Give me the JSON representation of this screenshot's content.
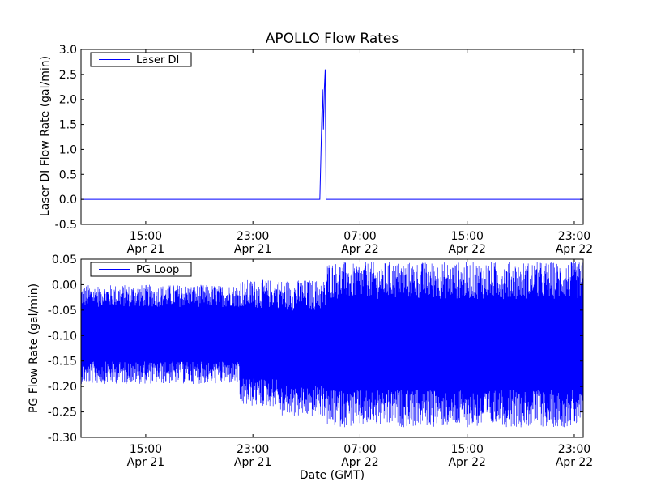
{
  "chart_data": [
    {
      "type": "line",
      "title": "APOLLO Flow Rates",
      "xlabel": "",
      "ylabel": "Laser DI Flow Rate (gal/min)",
      "ylim": [
        -0.5,
        3.0
      ],
      "yticks": [
        "-0.5",
        "0.0",
        "0.5",
        "1.0",
        "1.5",
        "2.0",
        "2.5",
        "3.0"
      ],
      "xticks": [
        {
          "time": "15:00",
          "date": "Apr 21"
        },
        {
          "time": "23:00",
          "date": "Apr 21"
        },
        {
          "time": "07:00",
          "date": "Apr 22"
        },
        {
          "time": "15:00",
          "date": "Apr 22"
        },
        {
          "time": "23:00",
          "date": "Apr 22"
        }
      ],
      "xlim": [
        "Apr 21 10:10",
        "Apr 22 23:40"
      ],
      "grid": false,
      "legend_position": "top-left",
      "series": [
        {
          "name": "Laser DI",
          "color": "#0000ff",
          "points": [
            [
              "Apr 21 10:10",
              0.0
            ],
            [
              "Apr 22 04:00",
              0.0
            ],
            [
              "Apr 22 04:08",
              1.5
            ],
            [
              "Apr 22 04:12",
              2.2
            ],
            [
              "Apr 22 04:16",
              1.4
            ],
            [
              "Apr 22 04:20",
              2.2
            ],
            [
              "Apr 22 04:24",
              2.6
            ],
            [
              "Apr 22 04:28",
              0.0
            ],
            [
              "Apr 22 23:40",
              0.0
            ]
          ]
        }
      ]
    },
    {
      "type": "line",
      "title": "",
      "xlabel": "Date (GMT)",
      "ylabel": "PG Flow Rate (gal/min)",
      "ylim": [
        -0.3,
        0.05
      ],
      "yticks": [
        "-0.30",
        "-0.25",
        "-0.20",
        "-0.15",
        "-0.10",
        "-0.05",
        "0.00",
        "0.05"
      ],
      "xticks": [
        {
          "time": "15:00",
          "date": "Apr 21"
        },
        {
          "time": "23:00",
          "date": "Apr 21"
        },
        {
          "time": "07:00",
          "date": "Apr 22"
        },
        {
          "time": "15:00",
          "date": "Apr 22"
        },
        {
          "time": "23:00",
          "date": "Apr 22"
        }
      ],
      "xlim": [
        "Apr 21 10:10",
        "Apr 22 23:40"
      ],
      "grid": false,
      "legend_position": "top-left",
      "series": [
        {
          "name": "PG Loop",
          "color": "#0000ff",
          "envelope": [
            {
              "from": "Apr 21 10:10",
              "to": "Apr 21 22:00",
              "max": 0.0,
              "min": -0.195
            },
            {
              "from": "Apr 21 22:00",
              "to": "Apr 22 01:00",
              "max": 0.01,
              "min": -0.24
            },
            {
              "from": "Apr 22 01:00",
              "to": "Apr 22 04:30",
              "max": 0.01,
              "min": -0.26
            },
            {
              "from": "Apr 22 04:30",
              "to": "Apr 22 23:40",
              "max": 0.045,
              "min": -0.28
            }
          ]
        }
      ]
    }
  ]
}
